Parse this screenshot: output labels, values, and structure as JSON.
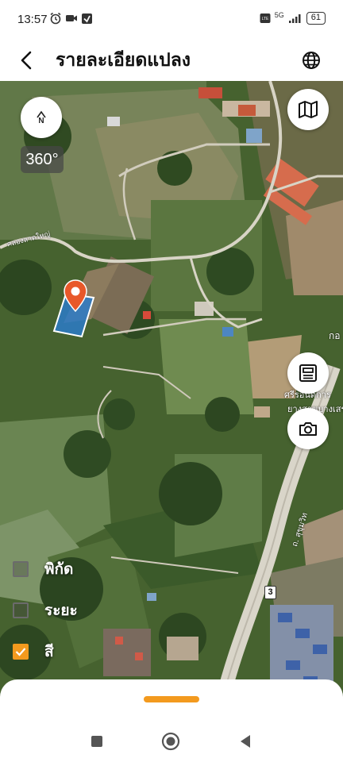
{
  "status_bar": {
    "time": "13:57",
    "battery": "61",
    "network": "5G"
  },
  "header": {
    "title": "รายละเอียดแปลง",
    "back_icon": "chevron-left-icon",
    "globe_icon": "globe-icon"
  },
  "map": {
    "compass_label": "N",
    "rotation_label": "360°",
    "road_labels": {
      "canal": "คลองลาดใหญ่",
      "highway": "ถ. สุขุมวิท",
      "highway_number": "3",
      "poi_1": "ศรีรอนต์การ",
      "poi_2": "ยางสาขบางเสร",
      "poi_3": "กอ"
    },
    "legend": [
      {
        "label": "พิกัด",
        "checked": false
      },
      {
        "label": "ระยะ",
        "checked": false
      },
      {
        "label": "สี",
        "checked": true
      }
    ],
    "accent_color": "#f39a1e",
    "parcel_color": "#2b7bc8"
  },
  "bottom_sheet": {
    "handle_color": "#f39a1e"
  }
}
